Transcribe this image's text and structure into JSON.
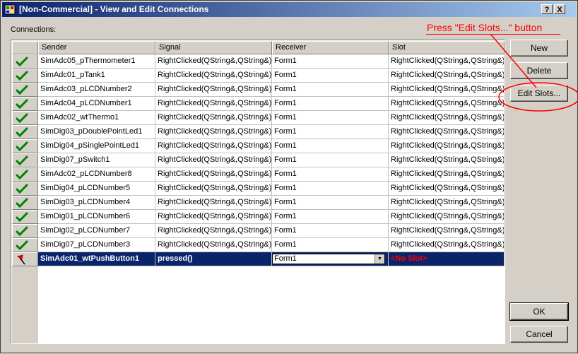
{
  "window": {
    "title": "[Non-Commercial] - View and Edit Connections",
    "help_label": "?",
    "close_label": "X"
  },
  "connections_label": "Connections:",
  "columns": [
    "Sender",
    "Signal",
    "Receiver",
    "Slot"
  ],
  "rows": [
    {
      "sender": "SimAdc05_pThermometer1",
      "signal": "RightClicked(QString&,QString&)",
      "receiver": "Form1",
      "slot": "RightClicked(QString&,QString&)"
    },
    {
      "sender": "SimAdc01_pTank1",
      "signal": "RightClicked(QString&,QString&)",
      "receiver": "Form1",
      "slot": "RightClicked(QString&,QString&)"
    },
    {
      "sender": "SimAdc03_pLCDNumber2",
      "signal": "RightClicked(QString&,QString&)",
      "receiver": "Form1",
      "slot": "RightClicked(QString&,QString&)"
    },
    {
      "sender": "SimAdc04_pLCDNumber1",
      "signal": "RightClicked(QString&,QString&)",
      "receiver": "Form1",
      "slot": "RightClicked(QString&,QString&)"
    },
    {
      "sender": "SimAdc02_wtThermo1",
      "signal": "RightClicked(QString&,QString&)",
      "receiver": "Form1",
      "slot": "RightClicked(QString&,QString&)"
    },
    {
      "sender": "SimDig03_pDoublePointLed1",
      "signal": "RightClicked(QString&,QString&)",
      "receiver": "Form1",
      "slot": "RightClicked(QString&,QString&)"
    },
    {
      "sender": "SimDig04_pSinglePointLed1",
      "signal": "RightClicked(QString&,QString&)",
      "receiver": "Form1",
      "slot": "RightClicked(QString&,QString&)"
    },
    {
      "sender": "SimDig07_pSwitch1",
      "signal": "RightClicked(QString&,QString&)",
      "receiver": "Form1",
      "slot": "RightClicked(QString&,QString&)"
    },
    {
      "sender": "SimAdc02_pLCDNumber8",
      "signal": "RightClicked(QString&,QString&)",
      "receiver": "Form1",
      "slot": "RightClicked(QString&,QString&)"
    },
    {
      "sender": "SimDig04_pLCDNumber5",
      "signal": "RightClicked(QString&,QString&)",
      "receiver": "Form1",
      "slot": "RightClicked(QString&,QString&)"
    },
    {
      "sender": "SimDig03_pLCDNumber4",
      "signal": "RightClicked(QString&,QString&)",
      "receiver": "Form1",
      "slot": "RightClicked(QString&,QString&)"
    },
    {
      "sender": "SimDig01_pLCDNumber6",
      "signal": "RightClicked(QString&,QString&)",
      "receiver": "Form1",
      "slot": "RightClicked(QString&,QString&)"
    },
    {
      "sender": "SimDig02_pLCDNumber7",
      "signal": "RightClicked(QString&,QString&)",
      "receiver": "Form1",
      "slot": "RightClicked(QString&,QString&)"
    },
    {
      "sender": "SimDig07_pLCDNumber3",
      "signal": "RightClicked(QString&,QString&)",
      "receiver": "Form1",
      "slot": "RightClicked(QString&,QString&)"
    }
  ],
  "selected_row": {
    "sender": "SimAdc01_wtPushButton1",
    "signal": "pressed()",
    "receiver": "Form1",
    "slot": "<No Slot>"
  },
  "buttons": {
    "new": "New",
    "delete": "Delete",
    "edit_slots": "Edit Slots...",
    "ok": "OK",
    "cancel": "Cancel"
  },
  "annotation": "Press \"Edit Slots...\" button",
  "colors": {
    "checkmark": "#008000",
    "selection": "#0a246a",
    "no_slot": "#ff0000",
    "annotation": "#ff0000"
  },
  "icons": {
    "row_status": "checkmark-icon",
    "selected_row_status": "pencil-flag-icon"
  }
}
